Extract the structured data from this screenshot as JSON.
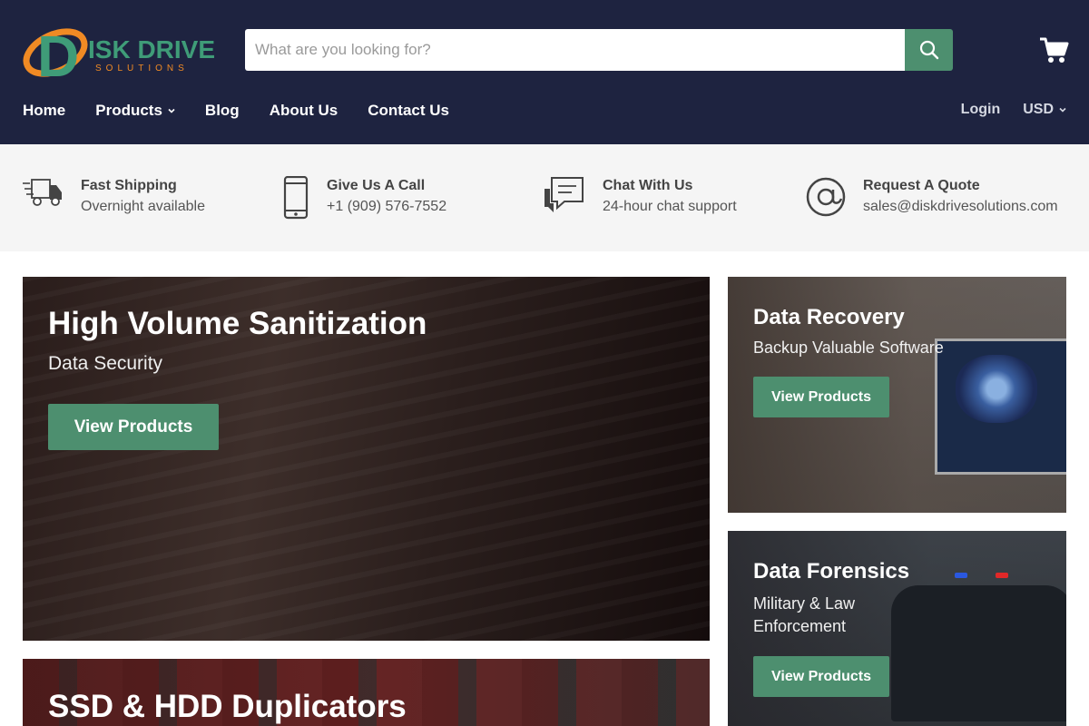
{
  "brand": {
    "logo_letter": "D",
    "logo_main": "ISK DRIVE",
    "logo_sub": "SOLUTIONS",
    "colors": {
      "orange": "#f08a24",
      "green": "#3f9c78",
      "navy": "#1e2340"
    }
  },
  "search": {
    "placeholder": "What are you looking for?",
    "value": "",
    "button_icon": "search-icon"
  },
  "cart": {
    "icon": "cart-icon"
  },
  "nav": {
    "items": [
      {
        "label": "Home"
      },
      {
        "label": "Products",
        "has_dropdown": true
      },
      {
        "label": "Blog"
      },
      {
        "label": "About Us"
      },
      {
        "label": "Contact Us"
      }
    ],
    "login": "Login",
    "currency": "USD"
  },
  "features": [
    {
      "icon": "truck-icon",
      "title": "Fast Shipping",
      "text": "Overnight available"
    },
    {
      "icon": "phone-icon",
      "title": "Give Us A Call",
      "text": "+1 (909) 576-7552"
    },
    {
      "icon": "chat-icon",
      "title": "Chat With Us",
      "text": "24-hour chat support"
    },
    {
      "icon": "at-icon",
      "title": "Request A Quote",
      "text": "sales@diskdrivesolutions.com"
    }
  ],
  "tiles": {
    "sanitization": {
      "title": "High Volume Sanitization",
      "subtitle": "Data Security",
      "button": "View Products"
    },
    "recovery": {
      "title": "Data Recovery",
      "subtitle": "Backup Valuable Software",
      "button": "View Products"
    },
    "forensics": {
      "title": "Data Forensics",
      "subtitle": "Military & Law Enforcement",
      "button": "View Products"
    },
    "duplicators": {
      "title": "SSD & HDD Duplicators"
    }
  },
  "accent_color": "#4d8f6f"
}
